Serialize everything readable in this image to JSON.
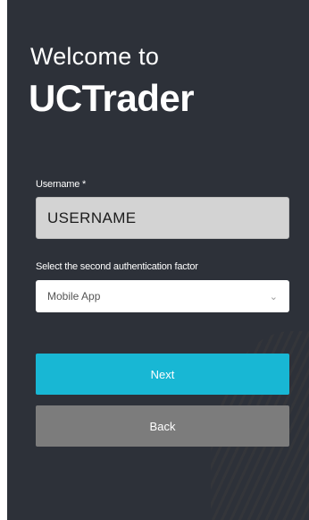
{
  "welcome_text": "Welcome to",
  "brand_name": "UCTrader",
  "username": {
    "label": "Username *",
    "value": "USERNAME"
  },
  "second_factor": {
    "label": "Select the second authentication factor",
    "selected": "Mobile App"
  },
  "buttons": {
    "next": "Next",
    "back": "Back"
  },
  "colors": {
    "panel_background": "#2d3139",
    "next_button": "#18b7d4",
    "back_button": "#7c7c7c",
    "input_background": "#d3d3d3"
  },
  "icons": {
    "select_chevron": "chevron-down-icon"
  }
}
